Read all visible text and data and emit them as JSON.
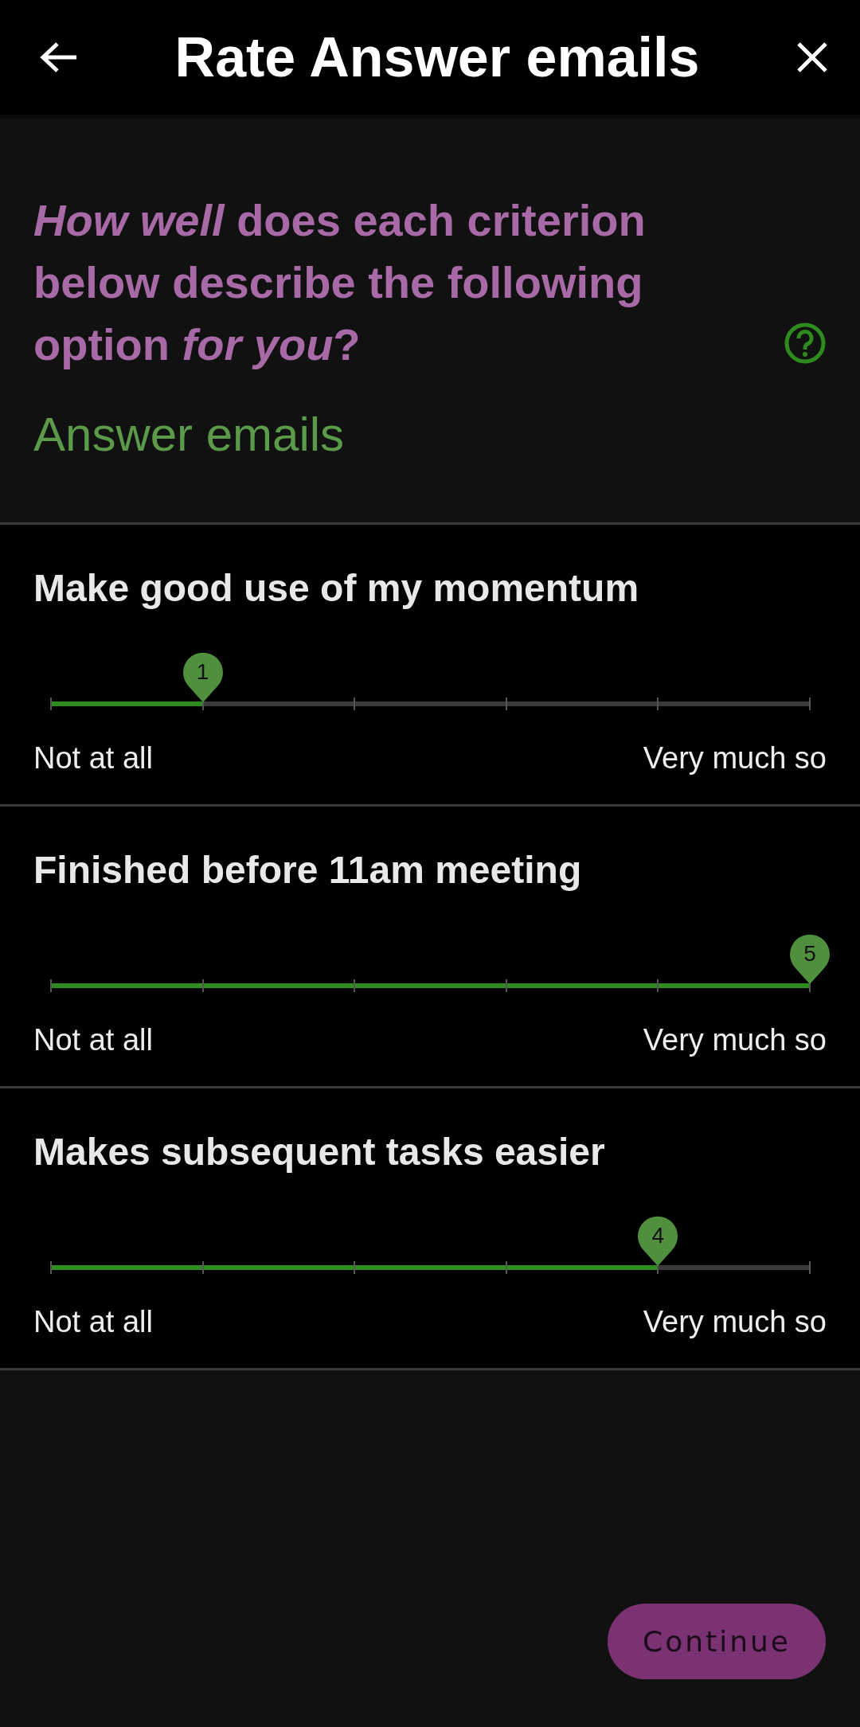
{
  "header": {
    "title": "Rate Answer emails"
  },
  "prompt": {
    "question": "*How well* does each criterion below describe the following option *for you*?",
    "option": "Answer emails"
  },
  "criteria": [
    {
      "title": "Make good use of my momentum",
      "level": 0.2,
      "value_label": "1",
      "min_label": "Not at all",
      "max_label": "Very much so"
    },
    {
      "title": "Finished before 11am meeting",
      "level": 1,
      "value_label": "5",
      "min_label": "Not at all",
      "max_label": "Very much so"
    },
    {
      "title": "Makes subsequent tasks easier",
      "level": 0.8,
      "value_label": "4",
      "min_label": "Not at all",
      "max_label": "Very much so"
    }
  ],
  "continue_button": "Continue"
}
